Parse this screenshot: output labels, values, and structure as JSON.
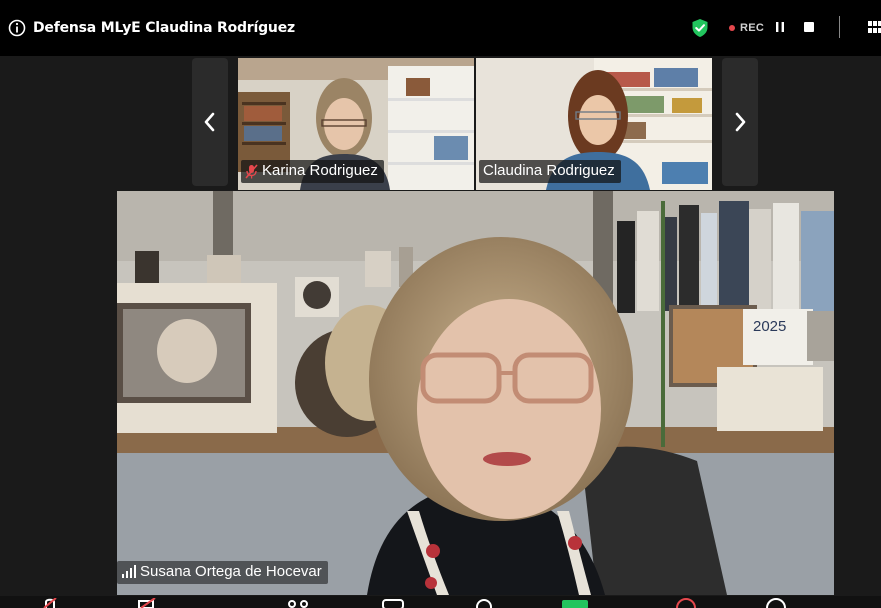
{
  "header": {
    "meeting_title": "Defensa MLyE Claudina Rodríguez",
    "recording_label": "REC",
    "colors": {
      "shield": "#22c55e",
      "rec_dot": "#e5484d"
    }
  },
  "gallery": {
    "prev_icon": "chevron-left-icon",
    "next_icon": "chevron-right-icon",
    "participants": [
      {
        "name": "Karina Rodriguez",
        "muted": true
      },
      {
        "name": "Claudina Rodriguez",
        "muted": false
      }
    ]
  },
  "speaker": {
    "name": "Susana Ortega de Hocevar",
    "indicator": "audio-level-icon",
    "calendar_text": "2025"
  },
  "toolbar": {
    "icons": [
      "mic-icon",
      "video-icon",
      "participants-icon",
      "share-screen-icon",
      "reactions-icon",
      "apps-icon",
      "leave-icon",
      "more-icon"
    ]
  }
}
